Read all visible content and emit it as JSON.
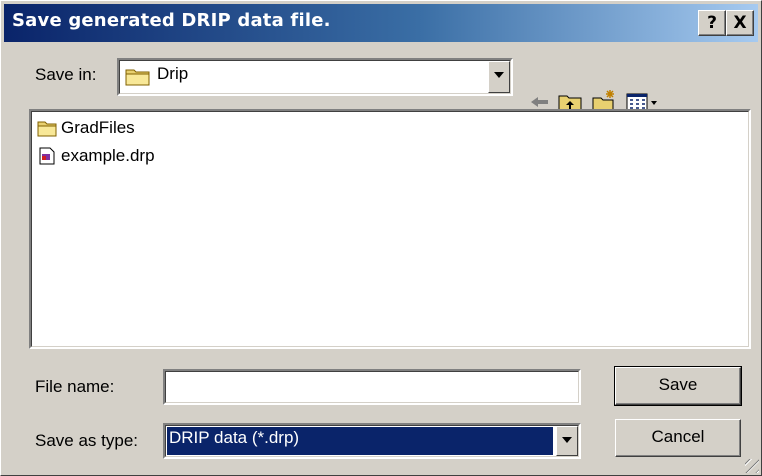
{
  "window": {
    "title": "Save generated DRIP data file.",
    "help_label": "?",
    "close_label": "X"
  },
  "save_in": {
    "label": "Save in:",
    "value": "Drip"
  },
  "toolbar": {
    "icons": [
      "back-arrow-icon",
      "up-one-level-icon",
      "create-new-folder-icon",
      "view-menu-icon"
    ]
  },
  "files": [
    {
      "name": "GradFiles",
      "icon": "folder-icon"
    },
    {
      "name": "example.drp",
      "icon": "drp-file-icon"
    }
  ],
  "filename": {
    "label": "File name:",
    "value": ""
  },
  "filetype": {
    "label": "Save as type:",
    "value": "DRIP data (*.drp)"
  },
  "buttons": {
    "save": "Save",
    "cancel": "Cancel"
  },
  "colors": {
    "title_start": "#0a246a",
    "title_end": "#a6caf0",
    "face": "#d4d0c8",
    "selection": "#0a246a"
  }
}
